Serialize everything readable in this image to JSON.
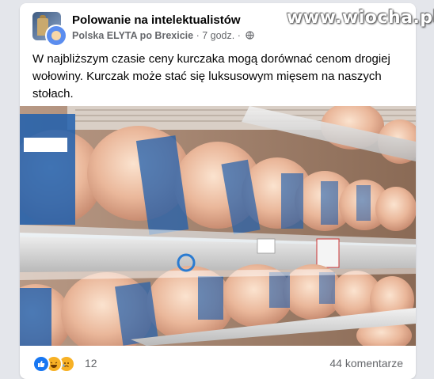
{
  "post": {
    "group_name": "Polowanie na intelektualistów",
    "author": "Polska ELYTA po Brexicie",
    "separator": "·",
    "time": "7 godz.",
    "visibility_icon": "globe-icon",
    "text": "W najbliższym czasie ceny kurczaka mogą dorównać cenom drogiej wołowiny. Kurczak może stać się luksusowym mięsem na naszych stołach.",
    "image": "store-shelves-with-packaged-whole-chickens"
  },
  "watermark": "www.wiocha.pl",
  "reactions": {
    "icons": [
      "like-icon",
      "haha-icon",
      "sad-icon"
    ],
    "count": "12"
  },
  "comments": {
    "label": "44 komentarze"
  },
  "colors": {
    "like": "#1877f2",
    "haha": "#f7b125",
    "text_secondary": "#65676b",
    "background": "#e4e6eb"
  }
}
